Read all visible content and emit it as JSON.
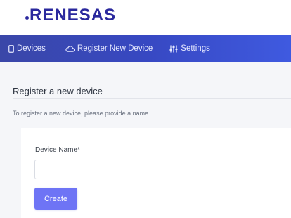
{
  "brand": {
    "logo_text": "RENESAS",
    "color": "#2a289d"
  },
  "nav": {
    "background": "#3a47a8",
    "items": [
      {
        "label": "Devices",
        "icon": "device-icon"
      },
      {
        "label": "Register New Device",
        "icon": "cloud-icon"
      },
      {
        "label": "Settings",
        "icon": "sliders-icon"
      }
    ]
  },
  "page": {
    "title": "Register a new device",
    "subtitle": "To register a new device, please provide a name"
  },
  "form": {
    "device_name_label": "Device Name*",
    "device_name_value": "",
    "device_name_placeholder": "",
    "create_label": "Create",
    "button_color": "#6e74f5"
  }
}
